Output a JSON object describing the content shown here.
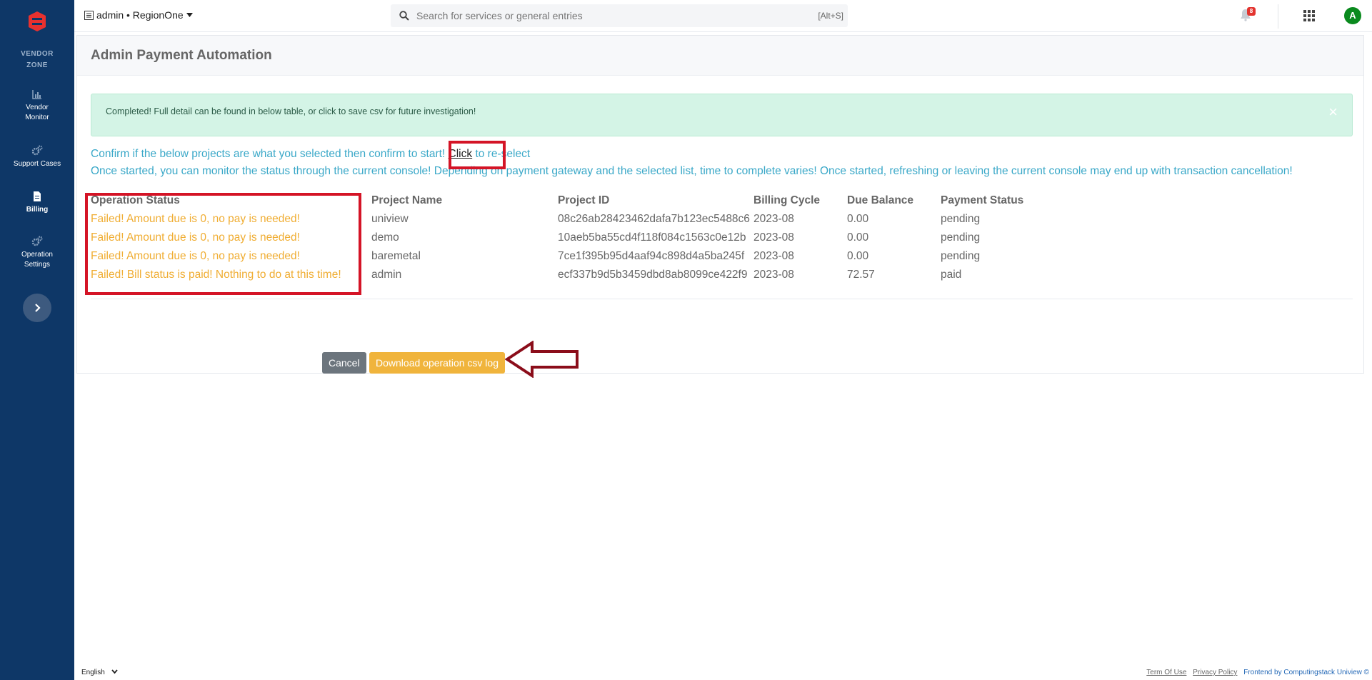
{
  "sidebar": {
    "brand": "VENDOR ZONE",
    "items": [
      {
        "label": "Vendor Monitor",
        "icon": "bar-chart-icon"
      },
      {
        "label": "Support Cases",
        "icon": "gears-icon"
      },
      {
        "label": "Billing",
        "icon": "document-icon",
        "active": true
      },
      {
        "label": "Operation Settings",
        "icon": "gears-icon"
      }
    ],
    "toggle_icon": "chevron-right-icon"
  },
  "topbar": {
    "project": "admin • RegionOne",
    "search_placeholder": "Search for services or general entries",
    "search_hint": "[Alt+S]",
    "notification_count": "8",
    "avatar_initial": "A"
  },
  "page": {
    "title": "Admin Payment Automation",
    "alert": "Completed! Full detail can be found in below table, or click to save csv for future investigation!",
    "alert_close": "×",
    "info_line1_prefix": "Confirm if the below projects are what you selected then confirm to start!",
    "info_link": "Click",
    "info_line1_suffix": "to re-select",
    "info_line2": "Once started, you can monitor the status through the current console! Depending on payment gateway and the selected list, time to complete varies! Once started, refreshing or leaving the current console may end up with transaction cancellation!"
  },
  "table": {
    "columns": [
      "Operation Status",
      "Project Name",
      "Project ID",
      "Billing Cycle",
      "Due Balance",
      "Payment Status"
    ],
    "rows": [
      {
        "status": "Failed! Amount due is 0, no pay is needed!",
        "name": "uniview",
        "id": "08c26ab28423462dafa7b123ec5488c6",
        "cycle": "2023-08",
        "balance": "0.00",
        "payment": "pending"
      },
      {
        "status": "Failed! Amount due is 0, no pay is needed!",
        "name": "demo",
        "id": "10aeb5ba55cd4f118f084c1563c0e12b",
        "cycle": "2023-08",
        "balance": "0.00",
        "payment": "pending"
      },
      {
        "status": "Failed! Amount due is 0, no pay is needed!",
        "name": "baremetal",
        "id": "7ce1f395b95d4aaf94c898d4a5ba245f",
        "cycle": "2023-08",
        "balance": "0.00",
        "payment": "pending"
      },
      {
        "status": "Failed! Bill status is paid! Nothing to do at this time!",
        "name": "admin",
        "id": "ecf337b9d5b3459dbd8ab8099ce422f9",
        "cycle": "2023-08",
        "balance": "72.57",
        "payment": "paid"
      }
    ]
  },
  "buttons": {
    "cancel": "Cancel",
    "download": "Download operation csv log"
  },
  "footer": {
    "language": "English",
    "terms": "Term Of Use",
    "privacy": "Privacy Policy",
    "credit": "Frontend by Computingstack Uniview ©"
  },
  "colors": {
    "sidebar": "#0e3767",
    "alert_bg": "#d4f4e6",
    "info_text": "#3aa8c8",
    "status_text": "#f0ad32",
    "download_button": "#f0b43c",
    "cancel_button": "#6c757d",
    "annotation": "#d41426"
  }
}
